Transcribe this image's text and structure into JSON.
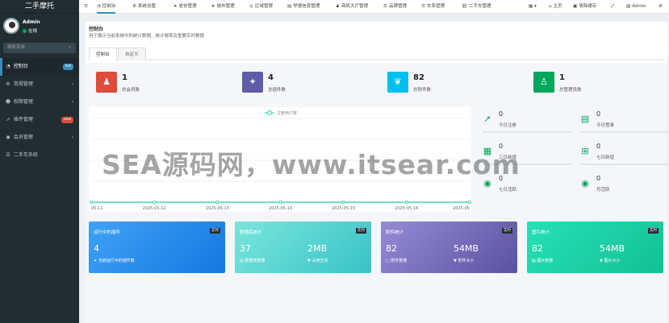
{
  "app": {
    "title": "二手摩托"
  },
  "user": {
    "name": "Admin",
    "status": "在线"
  },
  "search": {
    "placeholder": "搜索菜单",
    "icon": "search-icon"
  },
  "sidebar": {
    "items": [
      {
        "label": "控制台",
        "icon": "dashboard-icon",
        "badge": "hot",
        "active": true
      },
      {
        "label": "常规管理",
        "icon": "cog-icon"
      },
      {
        "label": "权限管理",
        "icon": "users-icon"
      },
      {
        "label": "插件管理",
        "icon": "rocket-icon",
        "badge": "new"
      },
      {
        "label": "会员管理",
        "icon": "user-circle-icon"
      },
      {
        "label": "二手车系统",
        "icon": "list-icon"
      }
    ]
  },
  "topnav": {
    "menu_icon": "☰",
    "items": [
      "控制台",
      "系统设置",
      "省份管理",
      "城市管理",
      "区域管理",
      "举报信息管理",
      "商机大厅管理",
      "品牌管理",
      "车系管理",
      "二手车管理"
    ],
    "right": {
      "home": "主页",
      "clear_cache": "清除缓存",
      "user": "Admin"
    }
  },
  "page": {
    "title": "控制台",
    "subtitle": "用于展示当前系统中的统计数据、统计报表及重要实时数据",
    "tabs": [
      "控制台",
      "自定义"
    ]
  },
  "stats": [
    {
      "value": "1",
      "label": "总会员数",
      "color": "#dd4b39",
      "icon": "users-icon"
    },
    {
      "value": "4",
      "label": "总插件数",
      "color": "#605ca8",
      "icon": "magic-icon"
    },
    {
      "value": "82",
      "label": "总附件数",
      "color": "#00c0ef",
      "icon": "leaf-icon"
    },
    {
      "value": "1",
      "label": "总管理员数",
      "color": "#00a65a",
      "icon": "user-icon"
    }
  ],
  "chart_data": {
    "type": "line",
    "legend": [
      "注册用户数"
    ],
    "categories": [
      "05-11",
      "2025-05-12",
      "2025-05-13",
      "2025-05-14",
      "2025-05-15",
      "2025-05-16",
      "2025-05"
    ],
    "series": [
      {
        "name": "注册用户数",
        "values": [
          0,
          0,
          0,
          0,
          0,
          0,
          0
        ]
      }
    ],
    "color": "#18d1b1"
  },
  "mini_stats": [
    {
      "value": "0",
      "label": "今日注册",
      "icon": "rocket-icon"
    },
    {
      "value": "0",
      "label": "今日登录",
      "icon": "vcard-icon"
    },
    {
      "value": "0",
      "label": "三日新增",
      "icon": "calendar-icon"
    },
    {
      "value": "0",
      "label": "七日新增",
      "icon": "calendar-plus-icon"
    },
    {
      "value": "0",
      "label": "七日活跃",
      "icon": "user-circle-icon"
    },
    {
      "value": "0",
      "label": "月活跃",
      "icon": "user-circle-icon"
    }
  ],
  "boxes": [
    {
      "title": "运行中的插件",
      "tag": "实时",
      "v1": "4",
      "l1": "当前运行中的插件数",
      "v2": "",
      "l2": "",
      "color1": "#2f98f3",
      "color2": "#1b7ce6"
    },
    {
      "title": "数据库统计",
      "tag": "实时",
      "v1": "37",
      "l1": "数据表数量",
      "v2": "2MB",
      "l2": "占用空间",
      "color1": "#6be0d7",
      "color2": "#3cc6c7"
    },
    {
      "title": "附件统计",
      "tag": "实时",
      "v1": "82",
      "l1": "附件数量",
      "v2": "54MB",
      "l2": "附件大小",
      "color1": "#8d83cf",
      "color2": "#6258a8"
    },
    {
      "title": "图片统计",
      "tag": "实时",
      "v1": "82",
      "l1": "图片数量",
      "v2": "54MB",
      "l2": "图片大小",
      "color1": "#1fdcb0",
      "color2": "#17c59d"
    }
  ],
  "watermark": "SEA源码网，www.itsear.com"
}
